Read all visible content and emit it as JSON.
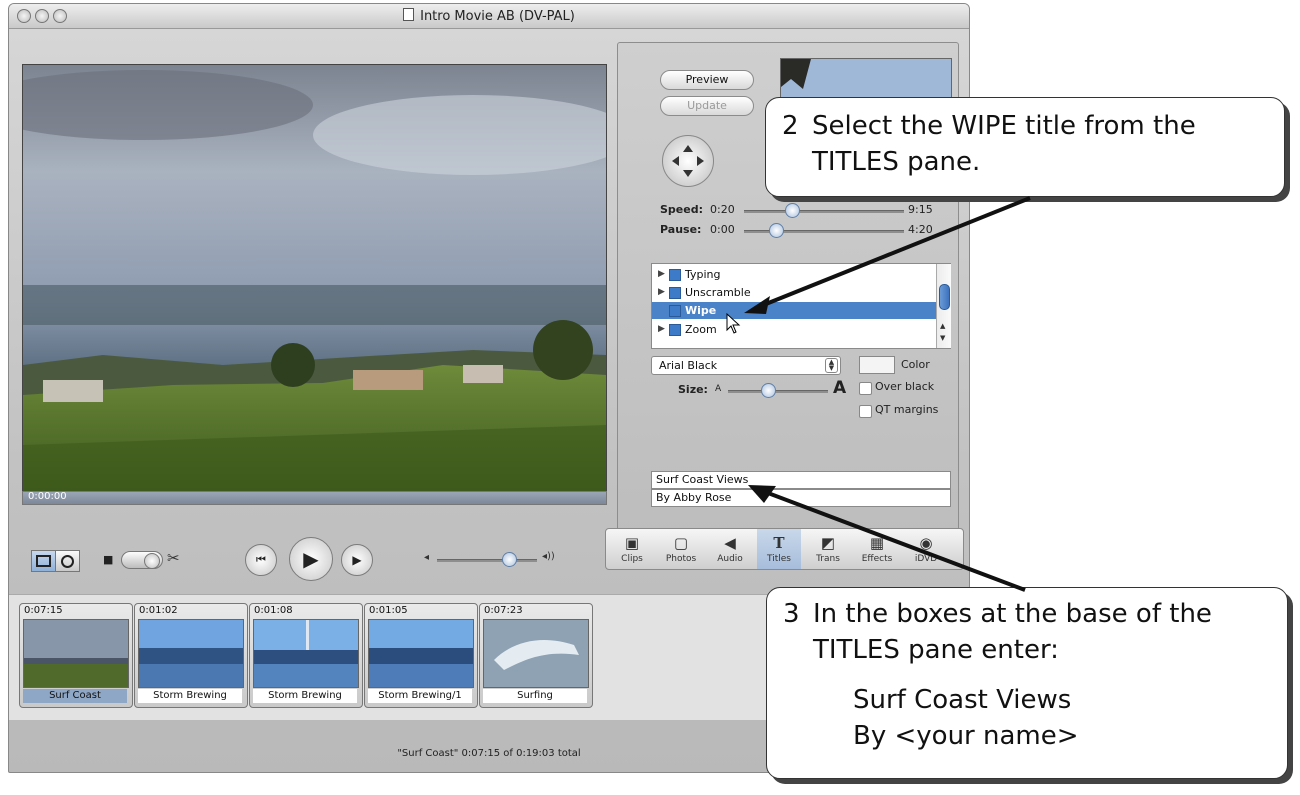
{
  "window": {
    "title": "Intro Movie AB (DV-PAL)"
  },
  "viewer": {
    "timecode": "0:00:00"
  },
  "titles_panel": {
    "preview_label": "Preview",
    "update_label": "Update",
    "speed_label": "Speed:",
    "speed_value": "0:20",
    "speed_max": "9:15",
    "speed_level": 0.3,
    "pause_label": "Pause:",
    "pause_value": "0:00",
    "pause_max": "4:20",
    "pause_level": 0.2,
    "title_list": [
      {
        "name": "Typing",
        "expandable": true,
        "selected": false
      },
      {
        "name": "Unscramble",
        "expandable": true,
        "selected": false
      },
      {
        "name": "Wipe",
        "expandable": false,
        "selected": true
      },
      {
        "name": "Zoom",
        "expandable": true,
        "selected": false
      }
    ],
    "font_select": "Arial Black",
    "color_label": "Color",
    "size_label": "Size:",
    "size_small": "A",
    "size_large": "A",
    "size_level": 0.4,
    "over_black_label": "Over black",
    "qt_margins_label": "QT margins",
    "text_line1": "Surf Coast Views",
    "text_line2": "By Abby Rose"
  },
  "tabs": [
    {
      "label": "Clips",
      "icon": "clips-icon"
    },
    {
      "label": "Photos",
      "icon": "photos-icon"
    },
    {
      "label": "Audio",
      "icon": "audio-icon"
    },
    {
      "label": "Titles",
      "icon": "titles-icon",
      "selected": true
    },
    {
      "label": "Trans",
      "icon": "trans-icon"
    },
    {
      "label": "Effects",
      "icon": "effects-icon"
    },
    {
      "label": "iDVD",
      "icon": "idvd-icon"
    }
  ],
  "clips": [
    {
      "time": "0:07:15",
      "name": "Surf Coast",
      "selected": true
    },
    {
      "time": "0:01:02",
      "name": "Storm Brewing"
    },
    {
      "time": "0:01:08",
      "name": "Storm Brewing"
    },
    {
      "time": "0:01:05",
      "name": "Storm Brewing/1"
    },
    {
      "time": "0:07:23",
      "name": "Surfing"
    }
  ],
  "status_text": "\"Surf Coast\"  0:07:15 of 0:19:03 total",
  "callouts": {
    "step2": {
      "number": "2",
      "line1": "Select the WIPE title from the",
      "line2": "TITLES pane."
    },
    "step3": {
      "number": "3",
      "line1": "In the boxes at the base of the",
      "line2": "TITLES pane enter:",
      "line3": "Surf Coast Views",
      "line4": "By <your name>"
    }
  },
  "colors": {
    "selection": "#4b83c8",
    "accent": "#a6bddb"
  }
}
